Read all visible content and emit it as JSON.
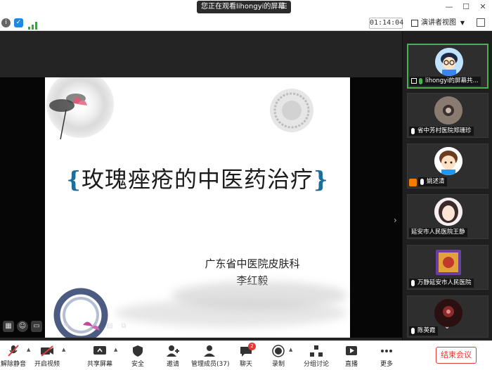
{
  "titlebar": {
    "viewing_text": "您正在观看lihongyi的屏幕",
    "menu_glyph": "☰",
    "min_glyph": "—",
    "max_glyph": "☐",
    "close_glyph": "✕"
  },
  "statusbar": {
    "timer": "01:14:04",
    "view_button": "演讲者视图",
    "caret": "▼"
  },
  "slide": {
    "title": "玫瑰痤疮的中医药治疗",
    "bracket_left": "{",
    "bracket_right": "}",
    "org": "广东省中医院皮肤科",
    "author": "李红毅"
  },
  "participants": [
    {
      "name": "lihongyi的屏幕共...",
      "muted": false
    },
    {
      "name": "省中芳村医院郑珊珍",
      "muted": false
    },
    {
      "name": "姚述清",
      "muted": false
    },
    {
      "name": "延安市人民医院王静",
      "muted": false
    },
    {
      "name": "万静延安市人民医院",
      "muted": false
    },
    {
      "name": "陈英霞",
      "muted": false
    }
  ],
  "toolbar": {
    "unmute": "解除静音",
    "start_video": "开启视频",
    "share_screen": "共享屏幕",
    "security": "安全",
    "invite": "邀请",
    "manage_members": "管理成员(37)",
    "chat": "聊天",
    "chat_count": "2",
    "record": "录制",
    "breakout": "分组讨论",
    "live": "直播",
    "more": "更多",
    "end_meeting": "结束会议"
  },
  "colors": {
    "accent_green": "#4caf50",
    "end_red": "#e53935",
    "title_bracket_blue": "#1d6e9a"
  }
}
